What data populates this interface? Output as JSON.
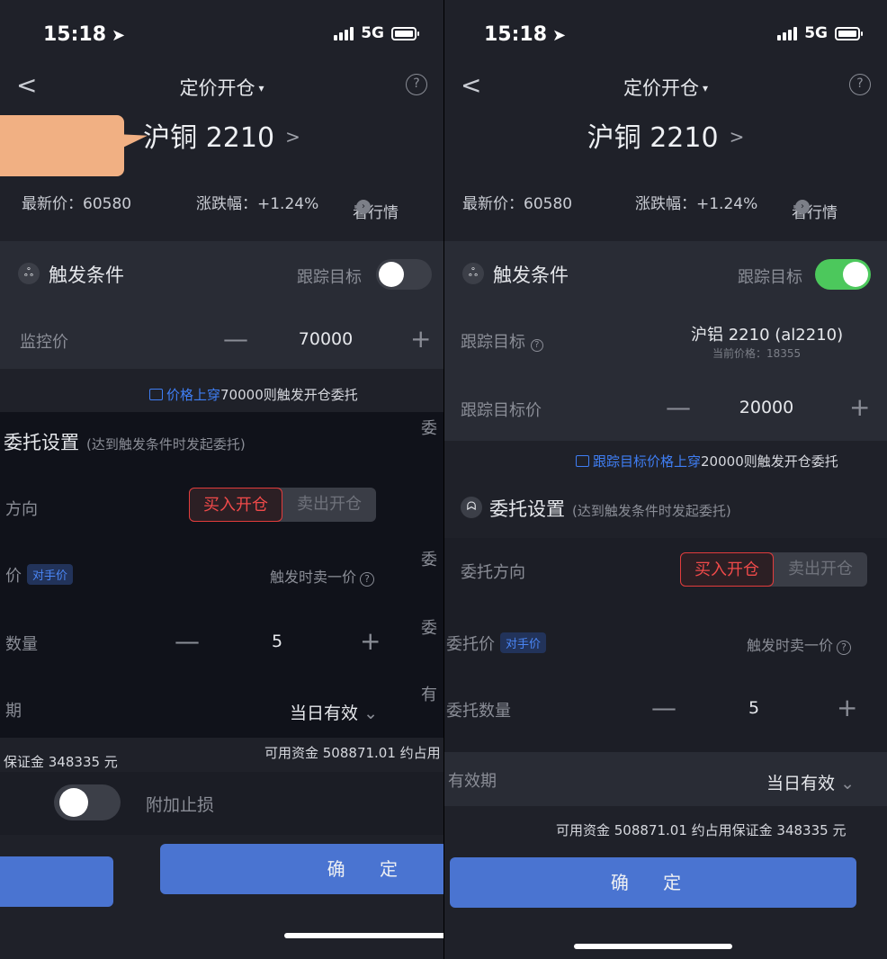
{
  "status": {
    "time": "15:18",
    "network": "5G"
  },
  "nav": {
    "back_label": "<",
    "title": "定价开仓",
    "help_label": "?"
  },
  "instrument": {
    "name": "沪铜 2210",
    "chevron": ">"
  },
  "quote": {
    "last_price_label": "最新价：60580",
    "change_label": "涨跌幅：+1.24%",
    "view_market_label": "看行情",
    "view_market_glyph": "›"
  },
  "trigger": {
    "section_title": "触发条件",
    "track_toggle_label": "跟踪目标",
    "icon_glyph": "ஃ"
  },
  "left": {
    "track_toggle_on": false,
    "monitor_label": "监控价",
    "monitor_value": "70000",
    "hint_prefix": "价格上穿",
    "hint_rest": "70000则触发开仓委托",
    "order_title": "委托设置",
    "order_sub": "(达到触发条件时发起委托)",
    "direction_label": "方向",
    "buy_label": "买入开仓",
    "sell_label": "卖出开仓",
    "price_label": "价",
    "price_pill": "对手价",
    "price_note": "触发时卖一价",
    "qty_label": "数量",
    "qty_value": "5",
    "validity_label": "期",
    "validity_value": "当日有效",
    "funds_right": "可用资金 508871.01 约占用",
    "margin_left": "保证金 348335 元",
    "stoploss_label": "附加止损",
    "confirm_label": "确 定",
    "cut_labels": [
      "委",
      "委",
      "委",
      "有"
    ]
  },
  "right": {
    "track_toggle_on": true,
    "target_label": "跟踪目标",
    "target_value": "沪铝 2210 (al2210)",
    "target_current": "当前价格：18355",
    "target_price_label": "跟踪目标价",
    "target_price_value": "20000",
    "hint_prefix": "跟踪目标价格上穿",
    "hint_rest": "20000则触发开仓委托",
    "order_title": "委托设置",
    "order_sub": "(达到触发条件时发起委托)",
    "direction_label": "委托方向",
    "buy_label": "买入开仓",
    "sell_label": "卖出开仓",
    "price_label": "委托价",
    "price_pill": "对手价",
    "price_note": "触发时卖一价",
    "qty_label": "委托数量",
    "qty_value": "5",
    "validity_label": "有效期",
    "validity_value": "当日有效",
    "funds": "可用资金 508871.01 约占用保证金 348335 元",
    "confirm_label": "确 定"
  },
  "glyphs": {
    "minus": "—",
    "plus": "+",
    "caret": "▾",
    "chev_down": "⌄",
    "q": "?"
  },
  "colors": {
    "accent_blue": "#4a74d1",
    "buy_red": "#f04a4a",
    "toggle_green": "#4cc85c",
    "callout_orange": "#f1b083"
  }
}
